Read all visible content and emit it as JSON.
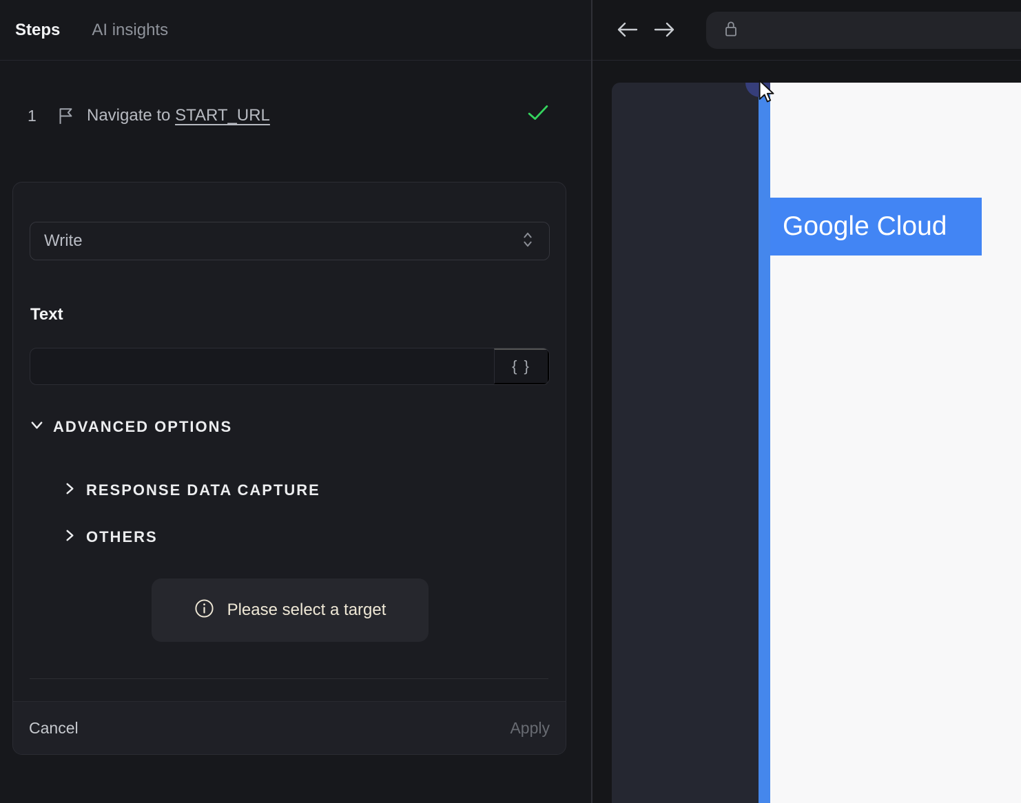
{
  "left_panel": {
    "tabs": [
      {
        "label": "Steps",
        "active": true
      },
      {
        "label": "AI insights",
        "active": false
      }
    ],
    "step": {
      "number": "1",
      "label_prefix": "Navigate to ",
      "label_link": "START_URL",
      "status": "success"
    },
    "editor": {
      "action_select": {
        "value": "Write"
      },
      "text_field": {
        "label": "Text",
        "value": "",
        "placeholder": ""
      },
      "variables_button_label": "{ }",
      "advanced_options": {
        "label": "ADVANCED OPTIONS",
        "expanded": true
      },
      "sections": [
        {
          "label": "RESPONSE DATA CAPTURE",
          "expanded": false
        },
        {
          "label": "OTHERS",
          "expanded": false
        }
      ],
      "notice": {
        "text": "Please select a target"
      },
      "footer": {
        "cancel": "Cancel",
        "apply": "Apply",
        "apply_enabled": false
      }
    }
  },
  "right_panel": {
    "toolbar": {
      "url_value": ""
    },
    "page": {
      "banner_text": "Google Cloud"
    }
  },
  "icons": [
    "flag-icon",
    "check-icon",
    "chevron-down-icon",
    "chevron-right-icon",
    "select-updown-icon",
    "info-icon",
    "braces-icon",
    "back-arrow-icon",
    "forward-arrow-icon",
    "lock-icon",
    "mouse-cursor-icon"
  ],
  "colors": {
    "panel_bg": "#17181c",
    "card_bg": "#1b1c21",
    "accent_blue": "#4285f4",
    "stripe_blue": "#4587ec",
    "success_green": "#35d45e",
    "notice_text": "#efe8d6",
    "page_bg": "#f8f8f9",
    "viewport_panel": "#252731",
    "highlight_circle": "#363e7a"
  }
}
